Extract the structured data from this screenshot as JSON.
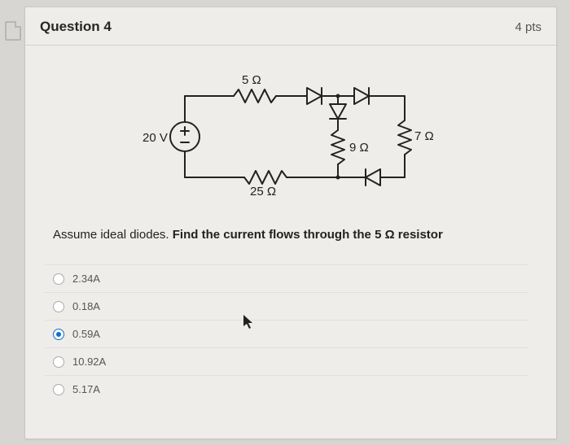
{
  "question": {
    "title": "Question 4",
    "points": "4 pts",
    "prompt_prefix": "Assume ideal diodes. ",
    "prompt_bold": "Find the current flows through the 5 Ω resistor"
  },
  "circuit": {
    "source_label": "20 V",
    "r_top": "5 Ω",
    "r_right": "7 Ω",
    "r_mid": "9 Ω",
    "r_bottom": "25 Ω"
  },
  "answers": [
    {
      "label": "2.34A",
      "selected": false
    },
    {
      "label": "0.18A",
      "selected": false
    },
    {
      "label": "0.59A",
      "selected": true
    },
    {
      "label": "10.92A",
      "selected": false
    },
    {
      "label": "5.17A",
      "selected": false
    }
  ]
}
